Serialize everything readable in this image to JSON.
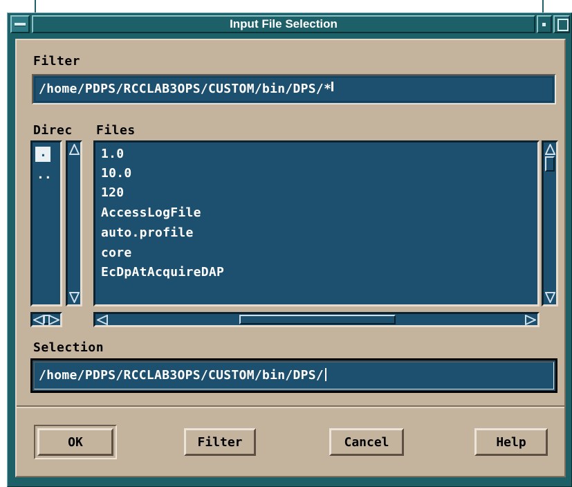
{
  "window": {
    "title": "Input File Selection"
  },
  "filter": {
    "label": "Filter",
    "value": "/home/PDPS/RCCLAB3OPS/CUSTOM/bin/DPS/*"
  },
  "directories": {
    "label": "Direc",
    "items": [
      ".",
      ".."
    ],
    "selected_index": 0
  },
  "files": {
    "label": "Files",
    "items": [
      "1.0",
      "10.0",
      "120",
      "AccessLogFile",
      "auto.profile",
      "core",
      "EcDpAtAcquireDAP"
    ]
  },
  "selection": {
    "label": "Selection",
    "value": "/home/PDPS/RCCLAB3OPS/CUSTOM/bin/DPS/"
  },
  "buttons": {
    "ok": "OK",
    "filter": "Filter",
    "cancel": "Cancel",
    "help": "Help"
  },
  "colors": {
    "frame": "#1e6068",
    "dialog_bg": "#c4b49e",
    "field_bg": "#1d4f6f",
    "text_light": "#ffffff"
  },
  "icons": {
    "window_menu": "window-menu-icon",
    "minimize": "minimize-icon",
    "maximize": "maximize-icon",
    "scroll_up": "arrow-up-icon",
    "scroll_down": "arrow-down-icon",
    "scroll_left": "arrow-left-icon",
    "scroll_right": "arrow-right-icon"
  }
}
